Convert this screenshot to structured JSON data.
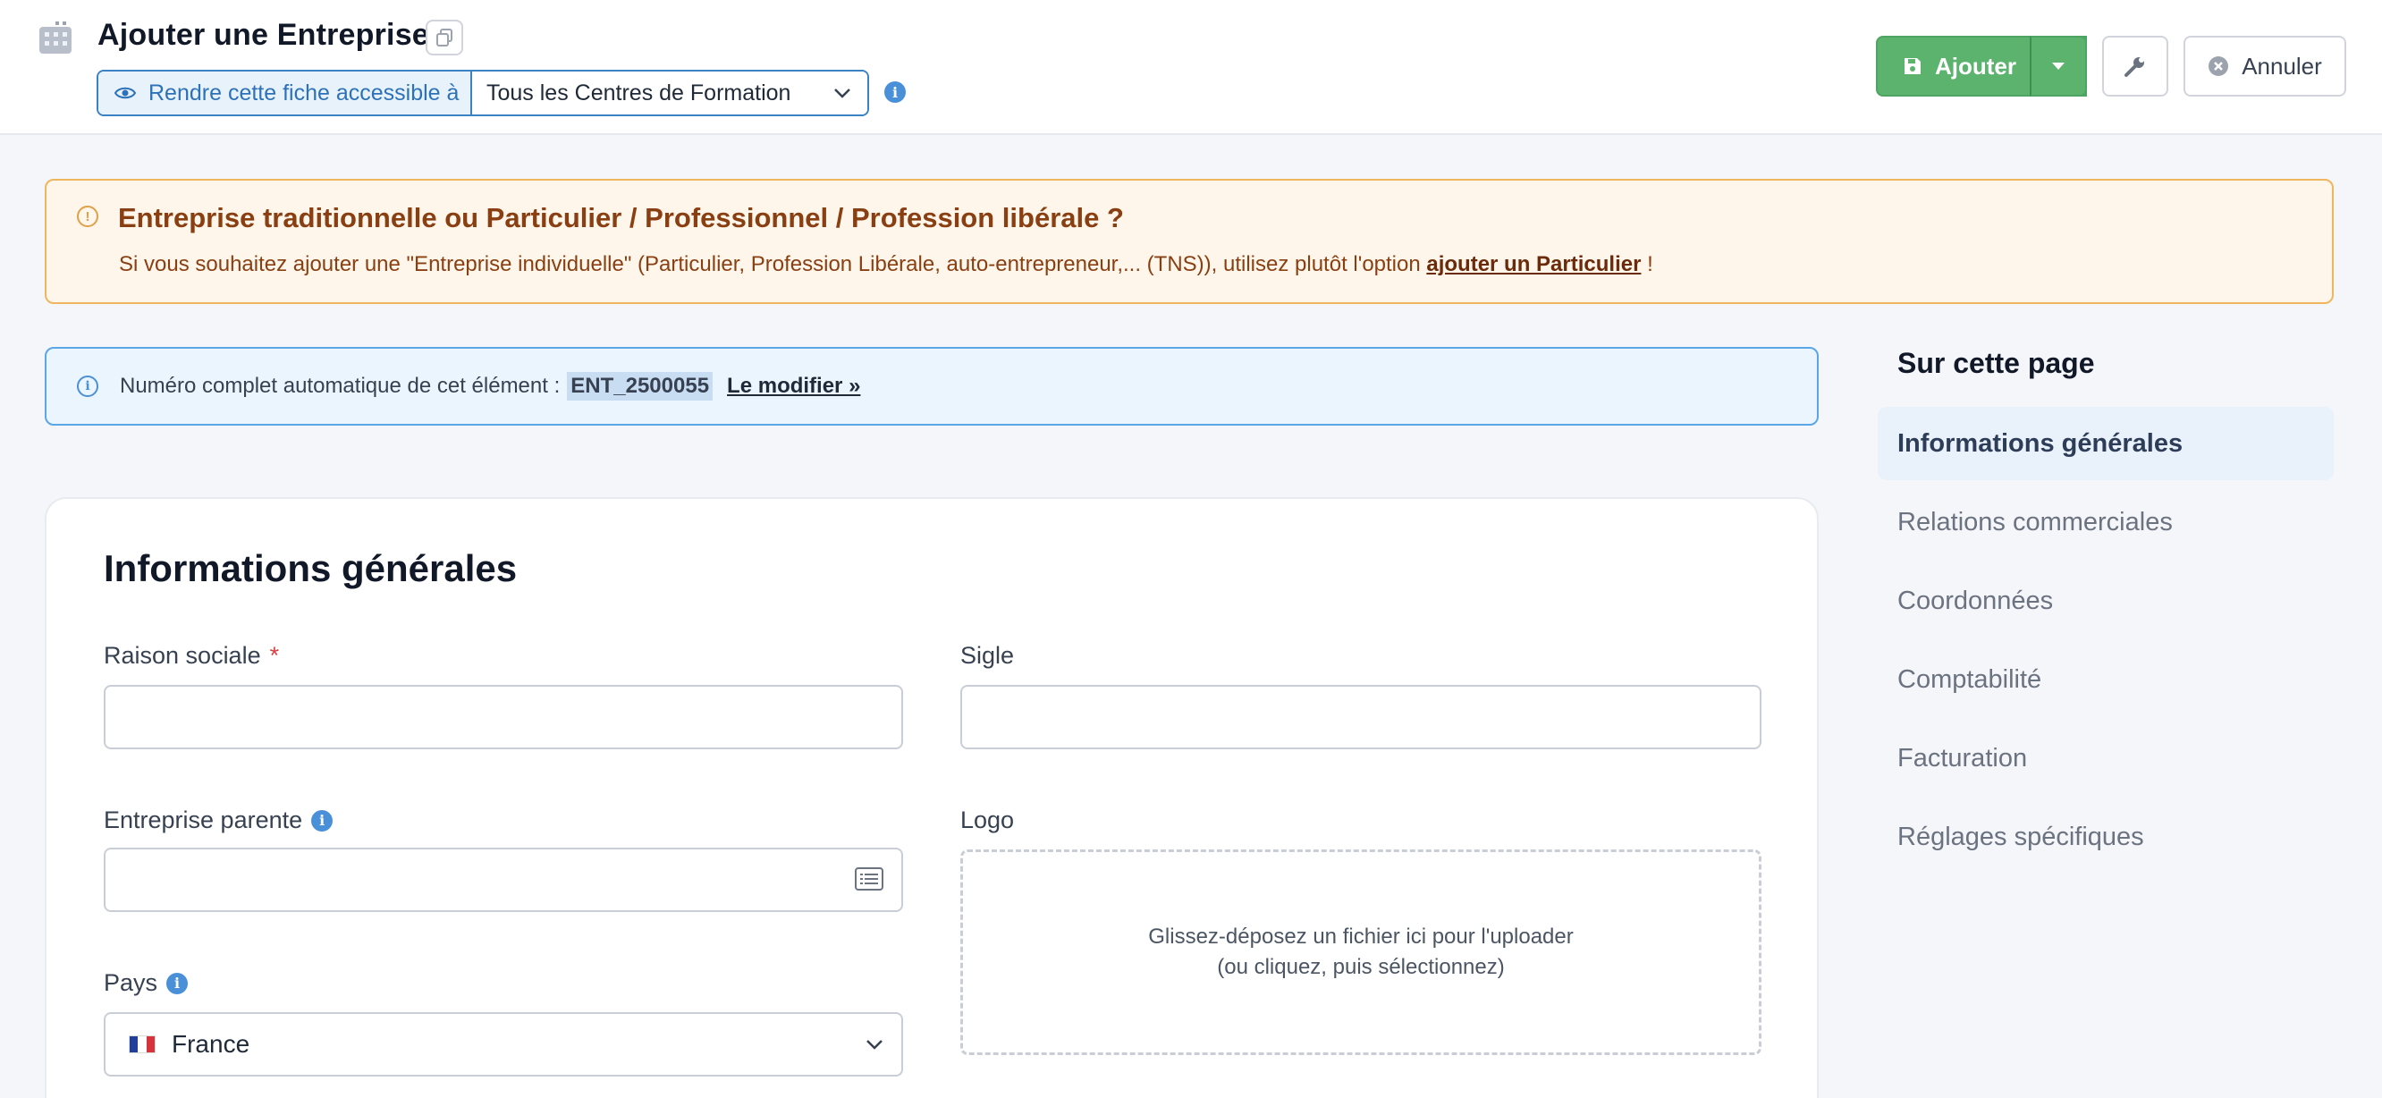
{
  "header": {
    "title": "Ajouter une Entreprise",
    "visibility_label": "Rendre cette fiche accessible à",
    "visibility_value": "Tous les Centres de Formation",
    "add_button": "Ajouter",
    "cancel_button": "Annuler"
  },
  "warning_alert": {
    "title": "Entreprise traditionnelle ou Particulier / Professionnel / Profession libérale ?",
    "text_before": "Si vous souhaitez ajouter une \"Entreprise individuelle\" (Particulier, Profession Libérale, auto-entrepreneur,... (TNS)), utilisez plutôt l'option ",
    "link": "ajouter un Particulier",
    "text_after": " !"
  },
  "info_alert": {
    "text": "Numéro complet automatique de cet élément :",
    "code": "ENT_2500055",
    "link": "Le modifier »"
  },
  "form": {
    "section_title": "Informations générales",
    "raison_sociale_label": "Raison sociale",
    "required_mark": "*",
    "sigle_label": "Sigle",
    "entreprise_parente_label": "Entreprise parente",
    "logo_label": "Logo",
    "dropzone_line1": "Glissez-déposez un fichier ici pour l'uploader",
    "dropzone_line2": "(ou cliquez, puis sélectionnez)",
    "pays_label": "Pays",
    "pays_value": "France"
  },
  "toc": {
    "title": "Sur cette page",
    "items": [
      {
        "label": "Informations générales",
        "active": true
      },
      {
        "label": "Relations commerciales",
        "active": false
      },
      {
        "label": "Coordonnées",
        "active": false
      },
      {
        "label": "Comptabilité",
        "active": false
      },
      {
        "label": "Facturation",
        "active": false
      },
      {
        "label": "Réglages spécifiques",
        "active": false
      }
    ]
  },
  "colors": {
    "primary_green": "#5cb36e",
    "info_blue": "#4a90d9",
    "warning_border": "#f0b55f",
    "warning_text": "#8a3f12"
  }
}
